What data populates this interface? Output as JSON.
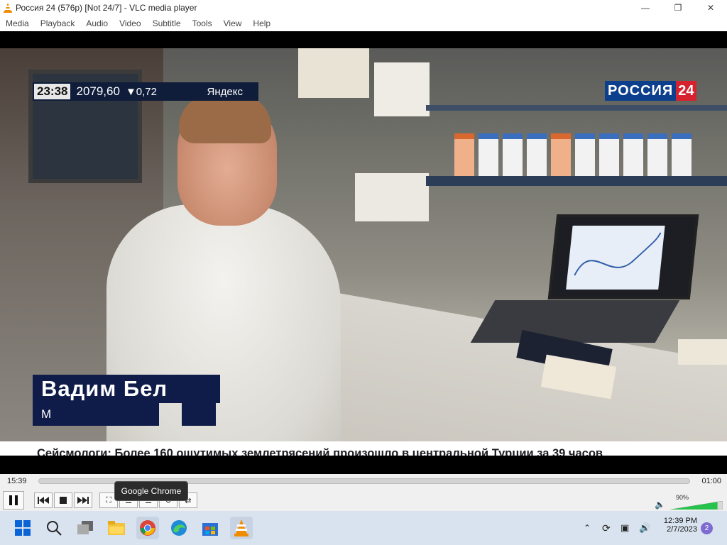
{
  "window": {
    "title": "Россия 24 (576p) [Not 24/7] - VLC media player",
    "app_icon": "vlc-cone-icon",
    "controls": [
      "minimize-icon",
      "maximize-icon",
      "close-icon"
    ]
  },
  "menu": {
    "items": [
      "Media",
      "Playback",
      "Audio",
      "Video",
      "Subtitle",
      "Tools",
      "View",
      "Help"
    ]
  },
  "overlay": {
    "clock": "23:38",
    "index_value": "2079,60",
    "index_change": "▼0,72",
    "source": "Яндекс",
    "channel_name": "РОССИЯ",
    "channel_number": "24",
    "person_name": "Вадим Бел",
    "person_role": "М",
    "crawl": "Сейсмологи: Более 160 ощутимых землетрясений произошло в центральной Турции за 39 часов"
  },
  "player": {
    "elapsed": "15:39",
    "remaining": "01:00",
    "seek_progress": 0,
    "volume_pct": "90%",
    "volume_level": 0.9,
    "buttons": [
      "pause-icon",
      "previous-icon",
      "stop-icon",
      "next-icon",
      "fullscreen-icon",
      "extended-settings-icon",
      "playlist-icon",
      "loop-icon",
      "random-icon"
    ],
    "tooltip": "Google Chrome",
    "colors": {
      "volume_fill": "#27c24c"
    }
  },
  "taskbar": {
    "icons": [
      "windows-start-icon",
      "search-icon",
      "task-view-icon",
      "file-explorer-icon",
      "chrome-icon",
      "edge-icon",
      "store-icon",
      "vlc-icon"
    ],
    "tray_icons": [
      "chevron-up-icon",
      "sync-icon",
      "network-icon",
      "speaker-icon"
    ],
    "time": "12:39 PM",
    "date": "2/7/2023",
    "notification_count": "2"
  }
}
